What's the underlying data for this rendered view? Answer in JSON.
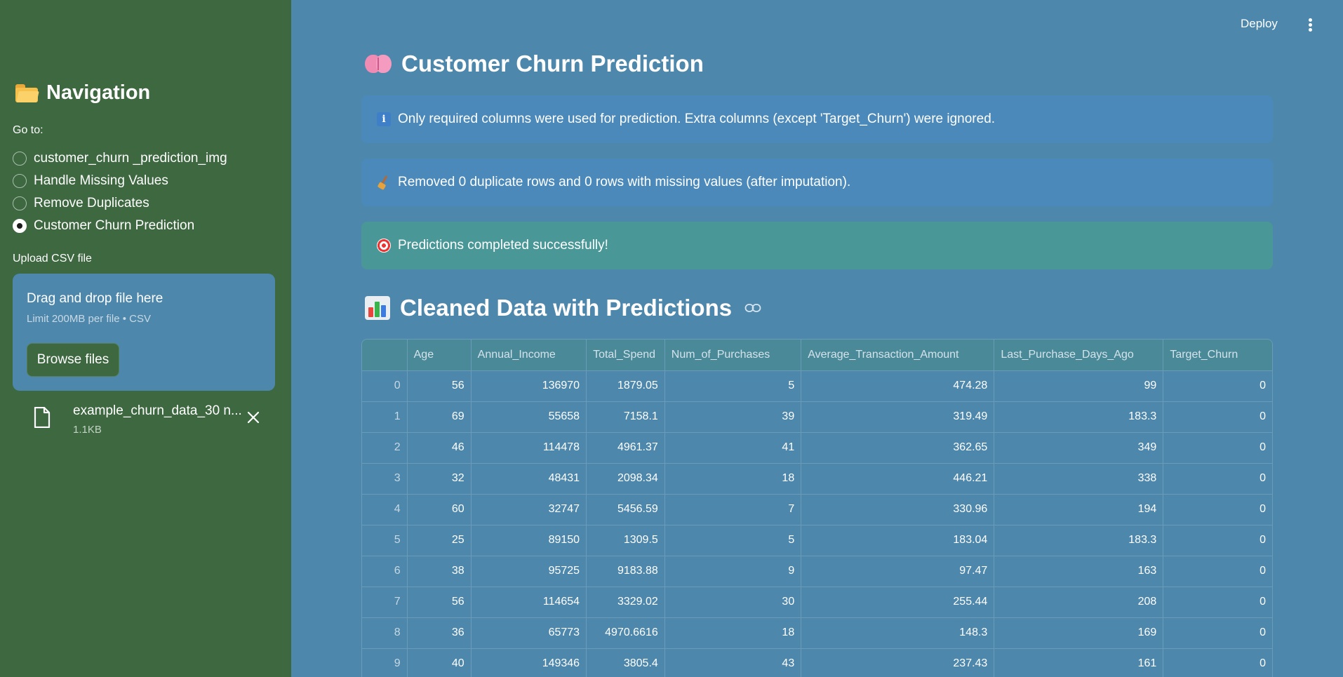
{
  "sidebar": {
    "title": "Navigation",
    "goto_label": "Go to:",
    "radio_options": [
      {
        "label": "customer_churn _prediction_img",
        "selected": false
      },
      {
        "label": "Handle Missing Values",
        "selected": false
      },
      {
        "label": "Remove Duplicates",
        "selected": false
      },
      {
        "label": "Customer Churn Prediction",
        "selected": true
      }
    ],
    "upload": {
      "label": "Upload CSV file",
      "dropzone_title": "Drag and drop file here",
      "dropzone_limit": "Limit 200MB per file • CSV",
      "browse_label": "Browse files",
      "file_name": "example_churn_data_30 n...",
      "file_size": "1.1KB"
    }
  },
  "header": {
    "deploy_label": "Deploy"
  },
  "main": {
    "title": "Customer Churn Prediction",
    "alerts": [
      {
        "type": "info",
        "icon": "info-icon",
        "text": "Only required columns were used for prediction. Extra columns (except 'Target_Churn') were ignored."
      },
      {
        "type": "info",
        "icon": "broom-icon",
        "text": "Removed 0 duplicate rows and 0 rows with missing values (after imputation)."
      },
      {
        "type": "success",
        "icon": "target-icon",
        "text": "Predictions completed successfully!"
      }
    ],
    "section_title": "Cleaned Data with Predictions",
    "table": {
      "columns": [
        "",
        "Age",
        "Annual_Income",
        "Total_Spend",
        "Num_of_Purchases",
        "Average_Transaction_Amount",
        "Last_Purchase_Days_Ago",
        "Target_Churn"
      ],
      "rows": [
        [
          "0",
          "56",
          "136970",
          "1879.05",
          "5",
          "474.28",
          "99",
          "0"
        ],
        [
          "1",
          "69",
          "55658",
          "7158.1",
          "39",
          "319.49",
          "183.3",
          "0"
        ],
        [
          "2",
          "46",
          "114478",
          "4961.37",
          "41",
          "362.65",
          "349",
          "0"
        ],
        [
          "3",
          "32",
          "48431",
          "2098.34",
          "18",
          "446.21",
          "338",
          "0"
        ],
        [
          "4",
          "60",
          "32747",
          "5456.59",
          "7",
          "330.96",
          "194",
          "0"
        ],
        [
          "5",
          "25",
          "89150",
          "1309.5",
          "5",
          "183.04",
          "183.3",
          "0"
        ],
        [
          "6",
          "38",
          "95725",
          "9183.88",
          "9",
          "97.47",
          "163",
          "0"
        ],
        [
          "7",
          "56",
          "114654",
          "3329.02",
          "30",
          "255.44",
          "208",
          "0"
        ],
        [
          "8",
          "36",
          "65773",
          "4970.6616",
          "18",
          "148.3",
          "169",
          "0"
        ],
        [
          "9",
          "40",
          "149346",
          "3805.4",
          "43",
          "237.43",
          "161",
          "0"
        ]
      ]
    }
  }
}
